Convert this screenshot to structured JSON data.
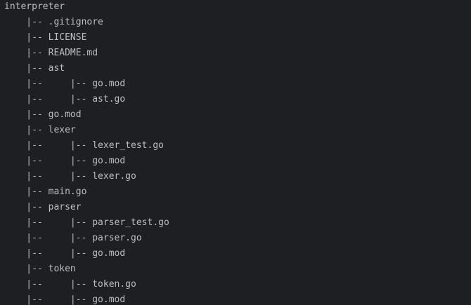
{
  "colors": {
    "background": "#1e1f22",
    "text": "#bcbec4"
  },
  "tree": {
    "root": "interpreter",
    "lines": [
      "    |-- .gitignore",
      "    |-- LICENSE",
      "    |-- README.md",
      "    |-- ast",
      "    |--     |-- go.mod",
      "    |--     |-- ast.go",
      "    |-- go.mod",
      "    |-- lexer",
      "    |--     |-- lexer_test.go",
      "    |--     |-- go.mod",
      "    |--     |-- lexer.go",
      "    |-- main.go",
      "    |-- parser",
      "    |--     |-- parser_test.go",
      "    |--     |-- parser.go",
      "    |--     |-- go.mod",
      "    |-- token",
      "    |--     |-- token.go",
      "    |--     |-- go.mod"
    ]
  }
}
